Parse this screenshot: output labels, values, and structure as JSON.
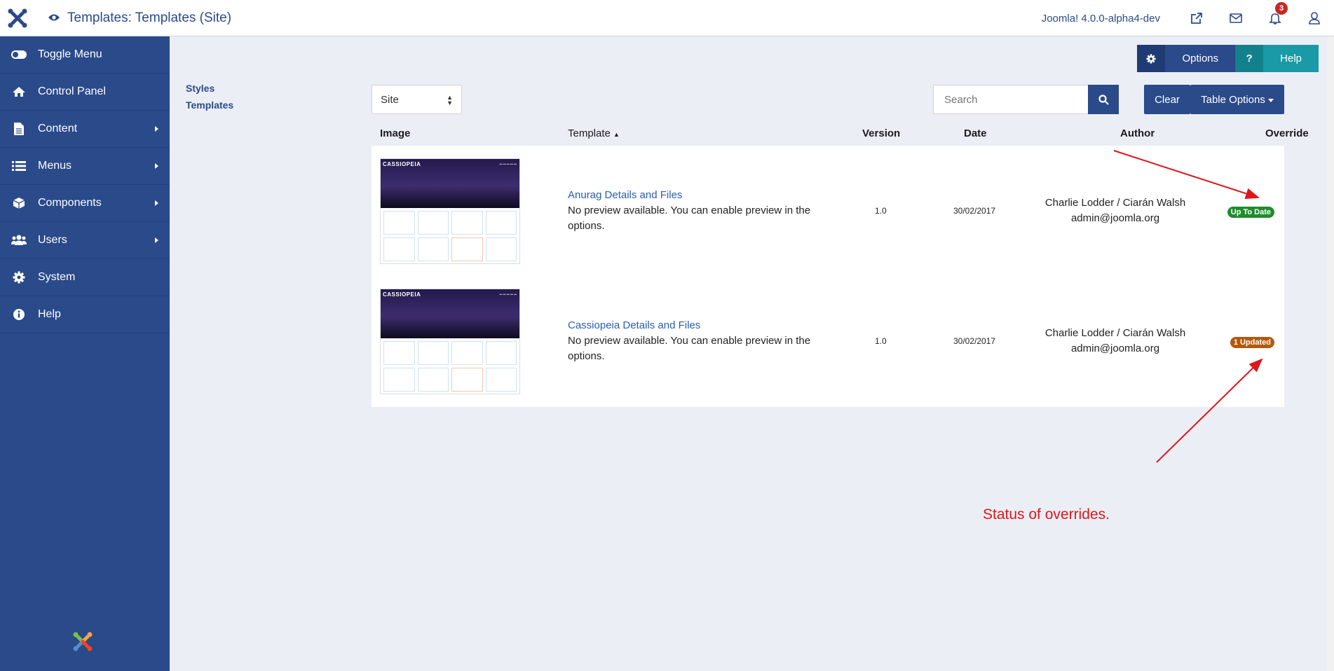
{
  "header": {
    "title": "Templates: Templates (Site)",
    "version": "Joomla! 4.0.0-alpha4-dev",
    "notifications_count": "3"
  },
  "sidebar": {
    "items": [
      {
        "label": "Toggle Menu",
        "icon": "toggle-icon"
      },
      {
        "label": "Control Panel",
        "icon": "home-icon"
      },
      {
        "label": "Content",
        "icon": "file-icon"
      },
      {
        "label": "Menus",
        "icon": "list-icon"
      },
      {
        "label": "Components",
        "icon": "cube-icon"
      },
      {
        "label": "Users",
        "icon": "users-icon"
      },
      {
        "label": "System",
        "icon": "gear-icon"
      },
      {
        "label": "Help",
        "icon": "info-icon"
      }
    ]
  },
  "subnav": {
    "styles": "Styles",
    "templates": "Templates"
  },
  "toolbar": {
    "options": "Options",
    "help": "Help"
  },
  "filters": {
    "client_selected": "Site",
    "search_placeholder": "Search",
    "clear": "Clear",
    "table_options": "Table Options"
  },
  "table": {
    "headers": {
      "image": "Image",
      "template": "Template",
      "version": "Version",
      "date": "Date",
      "author": "Author",
      "override": "Override"
    },
    "rows": [
      {
        "thumb_brand": "CASSIOPEIA",
        "name": "Anurag Details and Files",
        "description": "No preview available. You can enable preview in the options.",
        "version": "1.0",
        "date": "30/02/2017",
        "author": "Charlie Lodder / Ciarán Walsh",
        "email": "admin@joomla.org",
        "override": "Up To Date"
      },
      {
        "thumb_brand": "CASSIOPEIA",
        "name": "Cassiopeia Details and Files",
        "description": "No preview available. You can enable preview in the options.",
        "version": "1.0",
        "date": "30/02/2017",
        "author": "Charlie Lodder / Ciarán Walsh",
        "email": "admin@joomla.org",
        "override": "1 Updated"
      }
    ]
  },
  "annotation": "Status of overrides.",
  "colors": {
    "brand": "#2a4a8a",
    "up_to_date": "#1f8c2e",
    "updated": "#b25a0a",
    "annotation": "#e0151b"
  }
}
